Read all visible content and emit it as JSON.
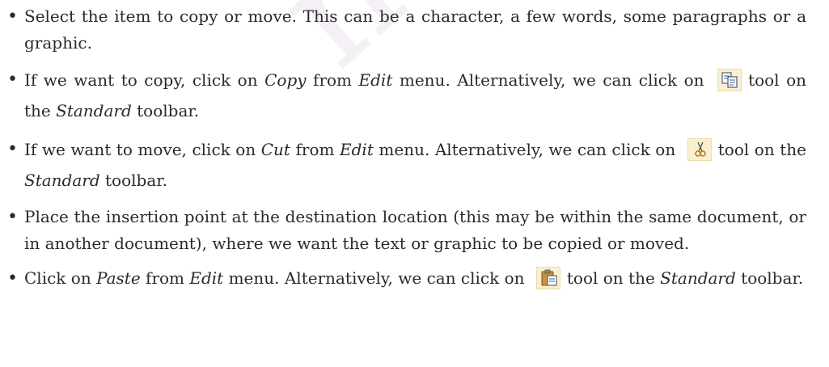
{
  "watermark": "not to be",
  "bullets": [
    {
      "text": "Select the item to copy or move. This can be a character, a few words, some paragraphs or a graphic."
    },
    {
      "part1": "If we want to copy, click on ",
      "em1": "Copy",
      "part2": " from ",
      "em2": "Edit",
      "part3": " menu. Alternatively, we can click on",
      "icon": "copy-icon",
      "part4": "tool on the ",
      "em3": "Standard",
      "part5": " toolbar."
    },
    {
      "part1": "If we want to move, click on ",
      "em1": "Cut",
      "part2": " from ",
      "em2": "Edit",
      "part3": " menu. Alternatively, we can click on",
      "icon": "cut-icon",
      "part4": "tool on the ",
      "em3": "Standard",
      "part5": " toolbar."
    },
    {
      "text": "Place the insertion point at the destination location (this may be within the same document, or in another document), where we want the text or graphic to be copied or moved."
    },
    {
      "part1": "Click on ",
      "em1": "Paste",
      "part2": " from ",
      "em2": "Edit",
      "part3": " menu. Alternatively, we can click on",
      "icon": "paste-icon",
      "part4": "tool on the ",
      "em3": "Standard",
      "part5": " toolbar."
    }
  ],
  "bullet_symbol": "•"
}
